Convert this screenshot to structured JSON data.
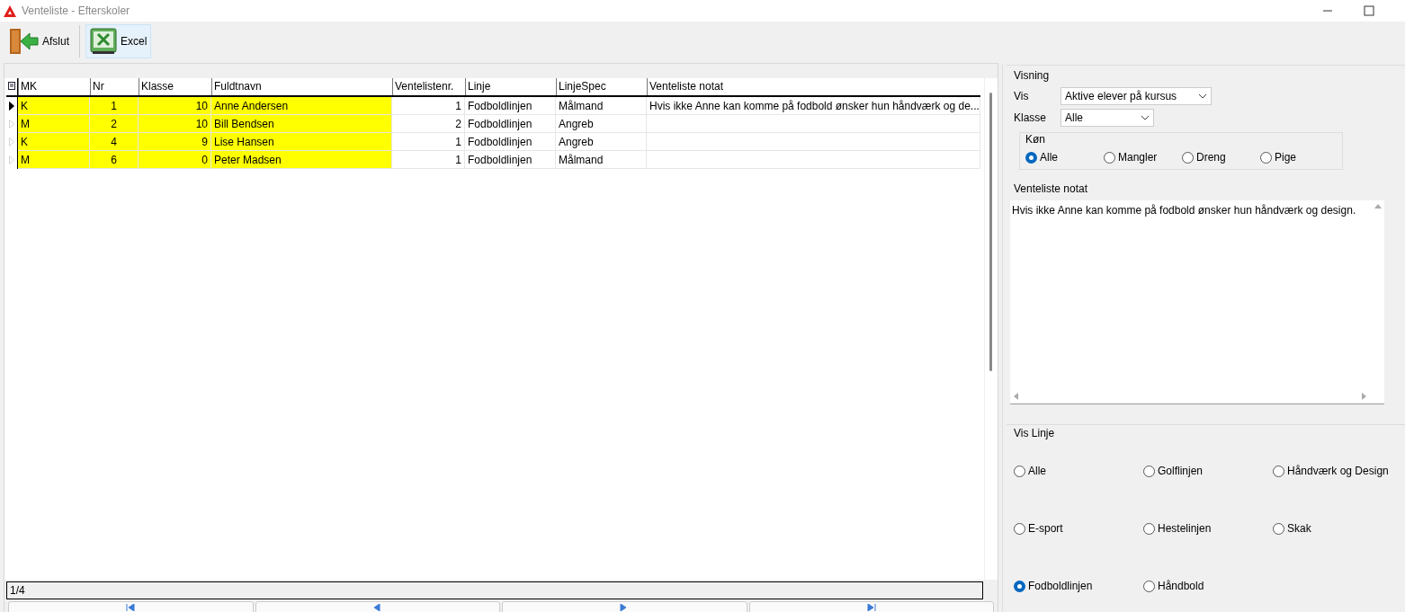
{
  "window": {
    "title": "Venteliste - Efterskoler"
  },
  "toolbar": [
    {
      "kind": "exit",
      "label": "Afslut",
      "selected": false
    },
    {
      "kind": "excel",
      "label": "Excel",
      "selected": true
    }
  ],
  "table": {
    "columns": [
      "MK",
      "Nr",
      "Klasse",
      "Fuldtnavn",
      "Ventelistenr.",
      "Linje",
      "LinjeSpec",
      "Venteliste notat"
    ],
    "rows": [
      {
        "current": true,
        "highlighted": true,
        "cells": [
          "K",
          "1",
          "10",
          "Anne Andersen",
          "1",
          "Fodboldlinjen",
          "Målmand",
          "Hvis ikke Anne kan komme på fodbold ønsker hun håndværk og de..."
        ]
      },
      {
        "current": false,
        "highlighted": true,
        "cells": [
          "M",
          "2",
          "10",
          "Bill Bendsen",
          "2",
          "Fodboldlinjen",
          "Angreb",
          ""
        ]
      },
      {
        "current": false,
        "highlighted": true,
        "cells": [
          "K",
          "4",
          "9",
          "Lise Hansen",
          "1",
          "Fodboldlinjen",
          "Angreb",
          ""
        ]
      },
      {
        "current": false,
        "highlighted": true,
        "cells": [
          "M",
          "6",
          "0",
          "Peter Madsen",
          "1",
          "Fodboldlinjen",
          "Målmand",
          ""
        ]
      }
    ],
    "record_counter": "1/4"
  },
  "visning": {
    "title": "Visning",
    "vis_label": "Vis",
    "vis_value": "Aktive elever på kursus",
    "klasse_label": "Klasse",
    "klasse_value": "Alle",
    "gender": {
      "title": "Køn",
      "options": [
        {
          "label": "Alle",
          "selected": true
        },
        {
          "label": "Mangler",
          "selected": false
        },
        {
          "label": "Dreng",
          "selected": false
        },
        {
          "label": "Pige",
          "selected": false
        }
      ]
    }
  },
  "note": {
    "label": "Venteliste notat",
    "value": "Hvis ikke Anne kan komme på fodbold ønsker hun håndværk og design."
  },
  "vis_linje": {
    "title": "Vis Linje",
    "options": [
      {
        "label": "Alle",
        "selected": false
      },
      {
        "label": "Golflinjen",
        "selected": false
      },
      {
        "label": "Håndværk og Design",
        "selected": false
      },
      {
        "label": "E-sport",
        "selected": false
      },
      {
        "label": "Hestelinjen",
        "selected": false
      },
      {
        "label": "Skak",
        "selected": false
      },
      {
        "label": "Fodboldlinjen",
        "selected": true
      },
      {
        "label": "Håndbold",
        "selected": false
      }
    ]
  }
}
